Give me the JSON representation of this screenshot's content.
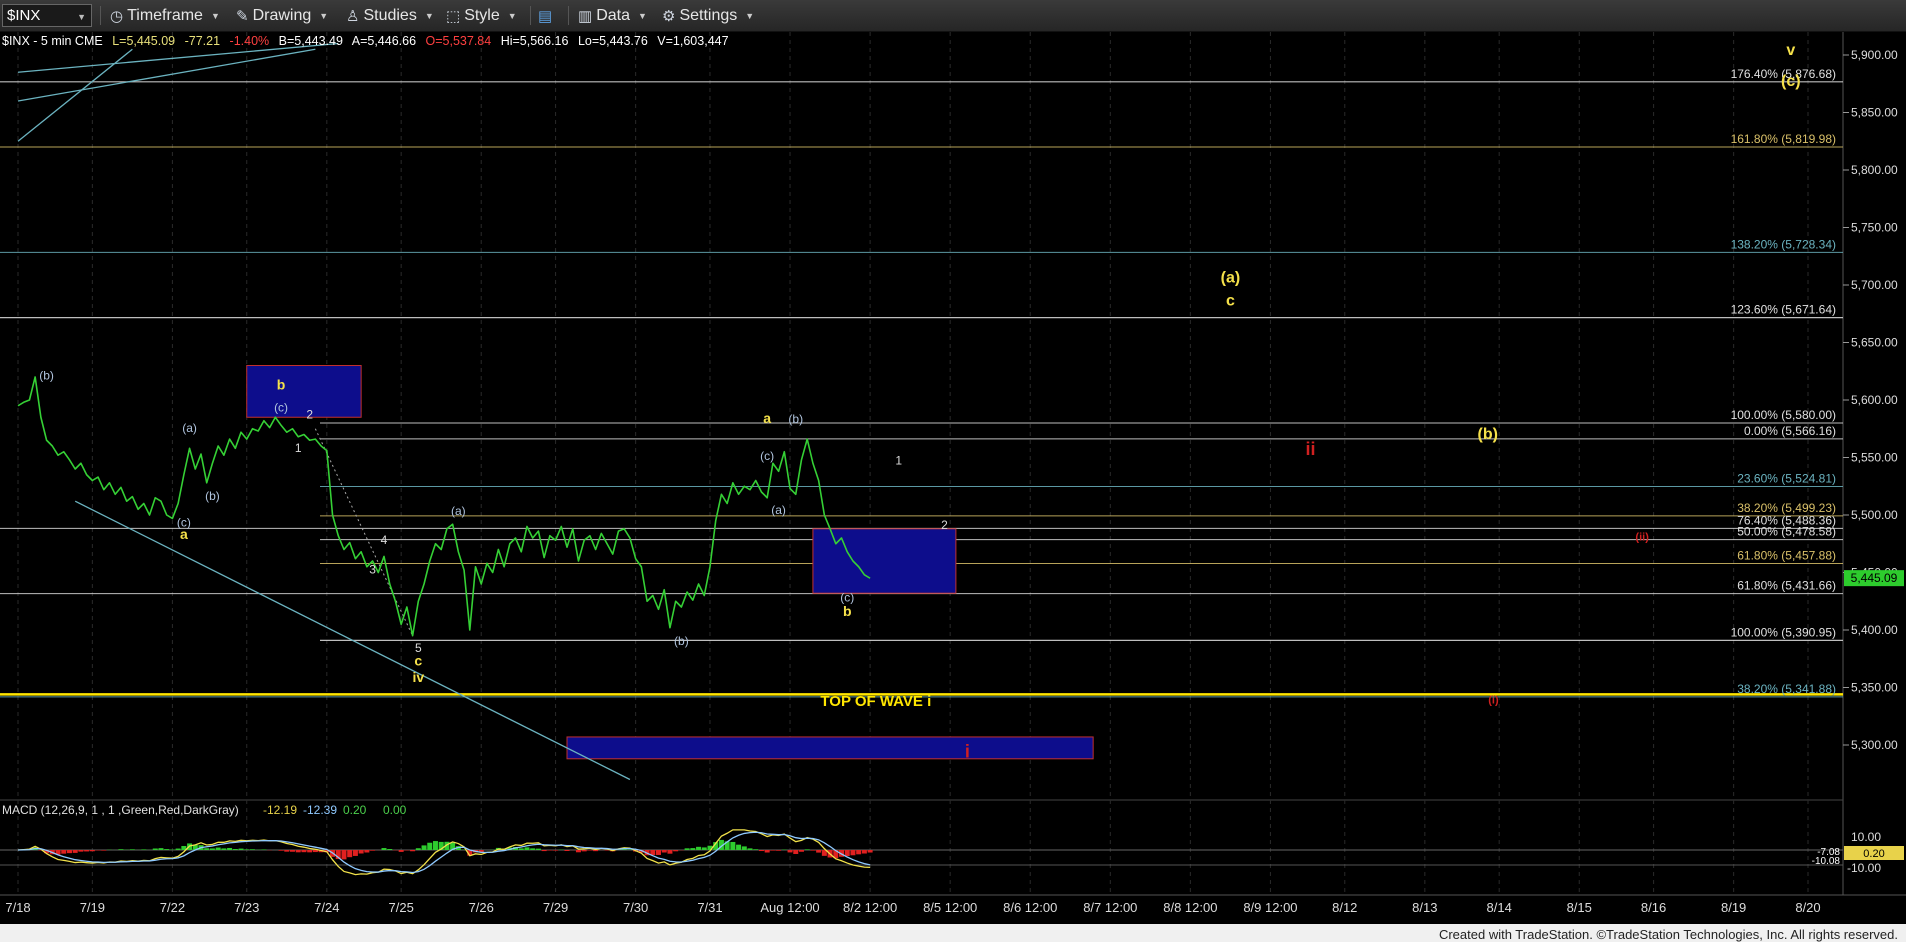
{
  "toolbar": {
    "symbol": "$INX",
    "timeframe": "Timeframe",
    "drawing": "Drawing",
    "studies": "Studies",
    "style": "Style",
    "data": "Data",
    "settings": "Settings"
  },
  "header": {
    "symbol_line": "$INX - 5 min  CME",
    "last": "L=5,445.09",
    "change": "-77.21",
    "change_pct": "-1.40%",
    "bid": "B=5,443.49",
    "ask": "A=5,446.66",
    "open": "O=5,537.84",
    "high": "Hi=5,566.16",
    "low": "Lo=5,443.76",
    "volume": "V=1,603,447"
  },
  "colors": {
    "price": "#35d035",
    "yellow": "#ffe600",
    "label_yellow": "#f5e14a",
    "blue_box": "#0d0d8c",
    "red": "#d02020",
    "fib_gold": "#d9c069",
    "fib_teal": "#6bb3c0",
    "fib_white": "#e0e0e0",
    "price_tag": "#2dcc2d",
    "macd_tag": "#e8d24a"
  },
  "chart_data": {
    "type": "line",
    "y_axis": {
      "min": 5260,
      "max": 5910,
      "ticks": [
        5300,
        5350,
        5400,
        5450,
        5500,
        5550,
        5600,
        5650,
        5700,
        5750,
        5800,
        5850,
        5900
      ],
      "tick_labels": [
        "5,300.00",
        "5,350.00",
        "5,400.00",
        "5,450.00",
        "5,500.00",
        "5,550.00",
        "5,600.00",
        "5,650.00",
        "5,700.00",
        "5,750.00",
        "5,800.00",
        "5,850.00",
        "5,900.00"
      ]
    },
    "x_ticks": [
      "7/18",
      "7/19",
      "7/22",
      "7/23",
      "7/24",
      "7/25",
      "7/26",
      "7/29",
      "7/30",
      "7/31",
      "Aug 12:00",
      "8/2 12:00",
      "8/5 12:00",
      "8/6 12:00",
      "8/7 12:00",
      "8/8 12:00",
      "8/9 12:00",
      "8/12",
      "8/13",
      "8/14",
      "8/15",
      "8/16",
      "8/19",
      "8/20"
    ],
    "x_tick_pos": [
      0,
      13,
      27,
      40,
      54,
      67,
      81,
      94,
      108,
      121,
      135,
      149,
      163,
      177,
      191,
      205,
      219,
      232,
      246,
      259,
      273,
      286,
      300,
      313
    ],
    "series": [
      {
        "values": [
          [
            0,
            5595
          ],
          [
            1,
            5598
          ],
          [
            2,
            5600
          ],
          [
            3,
            5620
          ],
          [
            4,
            5585
          ],
          [
            5,
            5565
          ],
          [
            6,
            5560
          ],
          [
            7,
            5552
          ],
          [
            8,
            5555
          ],
          [
            9,
            5548
          ],
          [
            10,
            5540
          ],
          [
            11,
            5545
          ],
          [
            12,
            5535
          ],
          [
            13,
            5530
          ],
          [
            14,
            5533
          ],
          [
            15,
            5522
          ],
          [
            16,
            5528
          ],
          [
            17,
            5518
          ],
          [
            18,
            5524
          ],
          [
            19,
            5512
          ],
          [
            20,
            5516
          ],
          [
            21,
            5505
          ],
          [
            22,
            5510
          ],
          [
            23,
            5500
          ],
          [
            24,
            5515
          ],
          [
            25,
            5512
          ],
          [
            26,
            5500
          ],
          [
            27,
            5497
          ],
          [
            28,
            5510
          ],
          [
            29,
            5535
          ],
          [
            30,
            5558
          ],
          [
            31,
            5540
          ],
          [
            32,
            5553
          ],
          [
            33,
            5528
          ],
          [
            34,
            5545
          ],
          [
            35,
            5560
          ],
          [
            36,
            5552
          ],
          [
            37,
            5566
          ],
          [
            38,
            5558
          ],
          [
            39,
            5572
          ],
          [
            40,
            5566
          ],
          [
            41,
            5575
          ],
          [
            42,
            5573
          ],
          [
            43,
            5582
          ],
          [
            44,
            5576
          ],
          [
            45,
            5585
          ],
          [
            46,
            5578
          ],
          [
            47,
            5572
          ],
          [
            48,
            5575
          ],
          [
            49,
            5568
          ],
          [
            50,
            5570
          ],
          [
            51,
            5565
          ],
          [
            52,
            5566
          ],
          [
            53,
            5560
          ],
          [
            54,
            5556
          ],
          [
            55,
            5500
          ],
          [
            56,
            5482
          ],
          [
            57,
            5470
          ],
          [
            58,
            5476
          ],
          [
            59,
            5462
          ],
          [
            60,
            5468
          ],
          [
            61,
            5455
          ],
          [
            62,
            5460
          ],
          [
            63,
            5450
          ],
          [
            64,
            5464
          ],
          [
            65,
            5440
          ],
          [
            66,
            5425
          ],
          [
            67,
            5405
          ],
          [
            68,
            5420
          ],
          [
            69,
            5395
          ],
          [
            70,
            5425
          ],
          [
            71,
            5440
          ],
          [
            72,
            5460
          ],
          [
            73,
            5475
          ],
          [
            74,
            5470
          ],
          [
            75,
            5488
          ],
          [
            76,
            5492
          ],
          [
            77,
            5468
          ],
          [
            78,
            5452
          ],
          [
            79,
            5400
          ],
          [
            80,
            5455
          ],
          [
            81,
            5440
          ],
          [
            82,
            5458
          ],
          [
            83,
            5450
          ],
          [
            84,
            5470
          ],
          [
            85,
            5455
          ],
          [
            86,
            5475
          ],
          [
            87,
            5480
          ],
          [
            88,
            5468
          ],
          [
            89,
            5490
          ],
          [
            90,
            5480
          ],
          [
            91,
            5486
          ],
          [
            92,
            5463
          ],
          [
            93,
            5482
          ],
          [
            94,
            5478
          ],
          [
            95,
            5490
          ],
          [
            96,
            5472
          ],
          [
            97,
            5488
          ],
          [
            98,
            5460
          ],
          [
            99,
            5478
          ],
          [
            100,
            5482
          ],
          [
            101,
            5470
          ],
          [
            102,
            5484
          ],
          [
            103,
            5475
          ],
          [
            104,
            5466
          ],
          [
            105,
            5486
          ],
          [
            106,
            5488
          ],
          [
            107,
            5480
          ],
          [
            108,
            5462
          ],
          [
            109,
            5455
          ],
          [
            110,
            5425
          ],
          [
            111,
            5430
          ],
          [
            112,
            5418
          ],
          [
            113,
            5435
          ],
          [
            114,
            5402
          ],
          [
            115,
            5425
          ],
          [
            116,
            5420
          ],
          [
            117,
            5433
          ],
          [
            118,
            5426
          ],
          [
            119,
            5440
          ],
          [
            120,
            5430
          ],
          [
            121,
            5455
          ],
          [
            122,
            5495
          ],
          [
            123,
            5518
          ],
          [
            124,
            5510
          ],
          [
            125,
            5528
          ],
          [
            126,
            5518
          ],
          [
            127,
            5525
          ],
          [
            128,
            5522
          ],
          [
            129,
            5530
          ],
          [
            130,
            5520
          ],
          [
            131,
            5515
          ],
          [
            132,
            5545
          ],
          [
            133,
            5538
          ],
          [
            134,
            5555
          ],
          [
            135,
            5523
          ],
          [
            136,
            5518
          ],
          [
            137,
            5548
          ],
          [
            138,
            5566
          ],
          [
            139,
            5545
          ],
          [
            140,
            5530
          ],
          [
            141,
            5500
          ],
          [
            142,
            5488
          ],
          [
            143,
            5475
          ],
          [
            144,
            5480
          ],
          [
            145,
            5468
          ],
          [
            146,
            5460
          ],
          [
            147,
            5455
          ],
          [
            148,
            5448
          ],
          [
            149,
            5445
          ]
        ]
      }
    ],
    "fib_labels": [
      {
        "text": "176.40% (5,876.68)",
        "price": 5876.68
      },
      {
        "text": "161.80% (5,819.98)",
        "price": 5819.98
      },
      {
        "text": "138.20% (5,728.34)",
        "price": 5728.34
      },
      {
        "text": "123.60% (5,671.64)",
        "price": 5671.64
      },
      {
        "text": "100.00% (5,580.00)",
        "price": 5580.0
      },
      {
        "text": "0.00% (5,566.16)",
        "price": 5566.16
      },
      {
        "text": "23.60% (5,524.81)",
        "price": 5524.81
      },
      {
        "text": "38.20% (5,499.23)",
        "price": 5499.23
      },
      {
        "text": "76.40% (5,488.36)",
        "price": 5488.36
      },
      {
        "text": "50.00% (5,478.58)",
        "price": 5478.58
      },
      {
        "text": "61.80% (5,457.88)",
        "price": 5457.88
      },
      {
        "text": "61.80% (5,431.66)",
        "price": 5431.66
      },
      {
        "text": "100.00% (5,390.95)",
        "price": 5390.95
      },
      {
        "text": "38.20% (5,341.88)",
        "price": 5341.88
      }
    ],
    "wave_labels": [
      {
        "text": "v",
        "price": 5900,
        "x": 310
      },
      {
        "text": "(c)",
        "price": 5873,
        "x": 310
      },
      {
        "text": "(a)",
        "price": 5702,
        "x": 212
      },
      {
        "text": "c",
        "price": 5682,
        "x": 212
      },
      {
        "text": "ii",
        "price": 5552,
        "x": 226
      },
      {
        "text": "(b)",
        "price": 5566,
        "x": 257
      },
      {
        "text": "a",
        "price": 5580,
        "x": 131
      },
      {
        "text": "(b)",
        "price": 5580,
        "x": 136
      },
      {
        "text": "b",
        "price": 5609,
        "x": 46
      },
      {
        "text": "(c)",
        "price": 5590,
        "x": 46
      },
      {
        "text": "2",
        "price": 5584,
        "x": 51
      },
      {
        "text": "1",
        "price": 5555,
        "x": 49
      },
      {
        "text": "(b)",
        "price": 5618,
        "x": 5
      },
      {
        "text": "(a)",
        "price": 5572,
        "x": 30
      },
      {
        "text": "(b)",
        "price": 5513,
        "x": 34
      },
      {
        "text": "(c)",
        "price": 5490,
        "x": 29
      },
      {
        "text": "a",
        "price": 5479,
        "x": 29
      },
      {
        "text": "(a)",
        "price": 5500,
        "x": 77
      },
      {
        "text": "4",
        "price": 5475,
        "x": 64
      },
      {
        "text": "3",
        "price": 5449,
        "x": 62
      },
      {
        "text": "5",
        "price": 5381,
        "x": 70
      },
      {
        "text": "c",
        "price": 5369,
        "x": 70
      },
      {
        "text": "iv",
        "price": 5355,
        "x": 70
      },
      {
        "text": "(c)",
        "price": 5548,
        "x": 131
      },
      {
        "text": "(a)",
        "price": 5501,
        "x": 133
      },
      {
        "text": "1",
        "price": 5544,
        "x": 154
      },
      {
        "text": "2",
        "price": 5488,
        "x": 162
      },
      {
        "text": "(c)",
        "price": 5425,
        "x": 145
      },
      {
        "text": "b",
        "price": 5412,
        "x": 145
      },
      {
        "text": "(b)",
        "price": 5387,
        "x": 116
      },
      {
        "text": "TOP OF WAVE i",
        "price": 5334,
        "x": 150
      },
      {
        "text": "i",
        "price": 5289,
        "x": 166
      },
      {
        "text": "(ii)",
        "price": 5478,
        "x": 284
      },
      {
        "text": "(i)",
        "price": 5336,
        "x": 258
      }
    ],
    "price_tag": "5,445.09",
    "macd": {
      "title": "MACD (12,26,9, 1 , 1 ,Green,Red,DarkGray)",
      "values": [
        "-12.19",
        "-12.39",
        "0.20",
        "0.00"
      ],
      "y_ticks": [
        "10.00",
        "-10.00"
      ],
      "tags": [
        "0.20",
        "-7.08",
        "-10.08"
      ]
    }
  },
  "footer": {
    "credit": "Created with TradeStation. ©TradeStation Technologies, Inc. All rights reserved."
  }
}
